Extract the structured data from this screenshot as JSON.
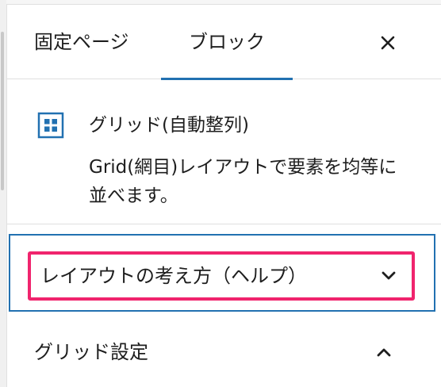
{
  "colors": {
    "accent": "#2271b1",
    "highlight": "#f0246d",
    "text": "#1e1e1e",
    "border": "#e0e0e0"
  },
  "tabs": [
    {
      "label": "固定ページ",
      "active": false
    },
    {
      "label": "ブロック",
      "active": true
    }
  ],
  "close": {
    "icon": "close-icon"
  },
  "block": {
    "icon": "grid-icon",
    "title": "グリッド(自動整列)",
    "description": "Grid(網目)レイアウトで要素を均等に並べます。"
  },
  "panels": {
    "help": {
      "title": "レイアウトの考え方（ヘルプ）",
      "icon": "chevron-down-icon",
      "expanded": false
    },
    "grid_settings": {
      "title": "グリッド設定",
      "icon": "chevron-up-icon",
      "expanded": true
    }
  }
}
